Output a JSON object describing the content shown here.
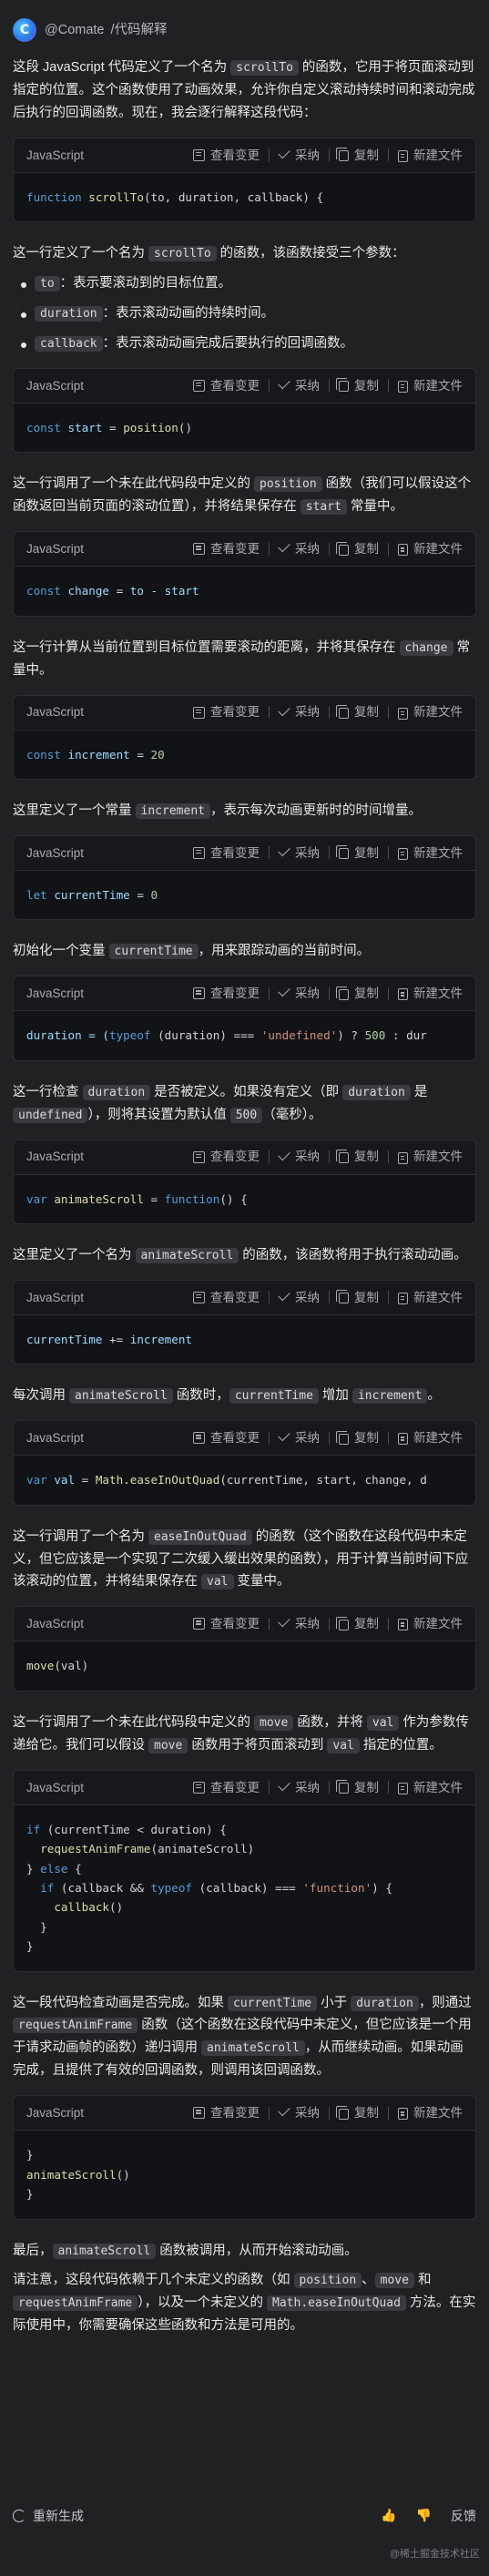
{
  "header": {
    "logo_glyph": "C",
    "brand": "@Comate",
    "tag": "/代码解释"
  },
  "code_toolbar": {
    "language": "JavaScript",
    "view_changes": "查看变更",
    "adopt": "采纳",
    "copy": "复制",
    "new_file": "新建文件"
  },
  "blocks": {
    "intro": {
      "t1": "这段 JavaScript 代码定义了一个名为 ",
      "c1": "scrollTo",
      "t2": " 的函数，它用于将页面滚动到指定的位置。这个函数使用了动画效果，允许你自定义滚动持续时间和滚动完成后执行的回调函数。现在，我会逐行解释这段代码："
    },
    "code1": {
      "kw": "function",
      "fn": "scrollTo",
      "rest": "(to, duration, callback) {"
    },
    "p_params": {
      "t1": "这一行定义了一个名为 ",
      "c1": "scrollTo",
      "t2": " 的函数，该函数接受三个参数："
    },
    "params": [
      {
        "code": "to",
        "desc": "：表示要滚动到的目标位置。"
      },
      {
        "code": "duration",
        "desc": "：表示滚动动画的持续时间。"
      },
      {
        "code": "callback",
        "desc": "：表示滚动动画完成后要执行的回调函数。"
      }
    ],
    "code2": {
      "kw": "const",
      "var": "start",
      "op": " = ",
      "fn": "position",
      "rest": "()"
    },
    "p2": {
      "t1": "这一行调用了一个未在此代码段中定义的 ",
      "c1": "position",
      "t2": " 函数（我们可以假设这个函数返回当前页面的滚动位置），并将结果保存在 ",
      "c2": "start",
      "t3": " 常量中。"
    },
    "code3": {
      "kw": "const",
      "var": "change",
      "op": " = ",
      "rest": "to - start"
    },
    "p3": {
      "t1": "这一行计算从当前位置到目标位置需要滚动的距离，并将其保存在 ",
      "c1": "change",
      "t2": " 常量中。"
    },
    "code4": {
      "kw": "const",
      "var": "increment",
      "op": " = ",
      "num": "20"
    },
    "p4": {
      "t1": "这里定义了一个常量 ",
      "c1": "increment",
      "t2": "，表示每次动画更新时的时间增量。"
    },
    "code5": {
      "kw": "let",
      "var": "currentTime",
      "op": " = ",
      "num": "0"
    },
    "p5": {
      "t1": "初始化一个变量 ",
      "c1": "currentTime",
      "t2": "，用来跟踪动画的当前时间。"
    },
    "code6": {
      "a": "duration = (",
      "kw": "typeof",
      "b": " (duration) === ",
      "str": "'undefined'",
      "c": ") ? ",
      "num": "500",
      "d": " : dur"
    },
    "p6": {
      "t1": "这一行检查 ",
      "c1": "duration",
      "t2": " 是否被定义。如果没有定义（即 ",
      "c2": "duration",
      "t3": " 是 ",
      "c3": "undefined",
      "t4": "），则将其设置为默认值 ",
      "c4": "500",
      "t5": "（毫秒）。"
    },
    "code7": {
      "kw": "var",
      "var": "animateScroll",
      "op": " = ",
      "kw2": "function",
      "rest": "() {"
    },
    "p7": {
      "t1": "这里定义了一个名为 ",
      "c1": "animateScroll",
      "t2": " 的函数，该函数将用于执行滚动动画。"
    },
    "code8": {
      "var": "currentTime",
      "op": " += ",
      "rest": "increment"
    },
    "p8": {
      "t1": "每次调用 ",
      "c1": "animateScroll",
      "t2": " 函数时，",
      "c2": "currentTime",
      "t3": " 增加 ",
      "c3": "increment",
      "t4": "。"
    },
    "code9": {
      "kw": "var",
      "var": "val",
      "op": " = ",
      "obj": "Math",
      "fn": ".easeInOutQuad",
      "rest": "(currentTime, start, change, d"
    },
    "p9": {
      "t1": "这一行调用了一个名为 ",
      "c1": "easeInOutQuad",
      "t2": " 的函数（这个函数在这段代码中未定义，但它应该是一个实现了二次缓入缓出效果的函数），用于计算当前时间下应该滚动的位置，并将结果保存在 ",
      "c2": "val",
      "t3": " 变量中。"
    },
    "code10": {
      "fn": "move",
      "rest": "(val)"
    },
    "p10": {
      "t1": "这一行调用了一个未在此代码段中定义的 ",
      "c1": "move",
      "t2": " 函数，并将 ",
      "c2": "val",
      "t3": " 作为参数传递给它。我们可以假设 ",
      "c3": "move",
      "t4": " 函数用于将页面滚动到 ",
      "c4": "val",
      "t5": " 指定的位置。"
    },
    "code11": {
      "l1_kw": "if",
      "l1_rest": " (currentTime < duration) {",
      "l2_fn": "requestAnimFrame",
      "l2_rest": "(animateScroll)",
      "l3_a": "} ",
      "l3_kw": "else",
      "l3_b": " {",
      "l4_kw": "if",
      "l4_a": " (callback && ",
      "l4_kw2": "typeof",
      "l4_b": " (callback) === ",
      "l4_str": "'function'",
      "l4_c": ") {",
      "l5_fn": "callback",
      "l5_rest": "()",
      "l6": "}",
      "l7": "}"
    },
    "p11": {
      "t1": "这一段代码检查动画是否完成。如果 ",
      "c1": "currentTime",
      "t2": " 小于 ",
      "c2": "duration",
      "t3": "，则通过 ",
      "c3": "requestAnimFrame",
      "t4": " 函数（这个函数在这段代码中未定义，但它应该是一个用于请求动画帧的函数）递归调用 ",
      "c4": "animateScroll",
      "t5": "，从而继续动画。如果动画完成，且提供了有效的回调函数，则调用该回调函数。"
    },
    "code12": {
      "l1": "}",
      "l2_fn": "animateScroll",
      "l2_rest": "()",
      "l3": "}"
    },
    "p12": {
      "t1": "最后，",
      "c1": "animateScroll",
      "t2": " 函数被调用，从而开始滚动动画。"
    },
    "p13": {
      "t1": "请注意，这段代码依赖于几个未定义的函数（如 ",
      "c1": "position",
      "t2": "、",
      "c2": "move",
      "t3": " 和 ",
      "c3": "requestAnimFrame",
      "t4": "），以及一个未定义的 ",
      "c4": "Math.easeInOutQuad",
      "t5": " 方法。在实际使用中，你需要确保这些函数和方法是可用的。"
    }
  },
  "footer": {
    "regenerate": "重新生成",
    "like": "👍",
    "dislike": "👎",
    "feedback": "反馈"
  },
  "watermark": "@稀土掘金技术社区"
}
